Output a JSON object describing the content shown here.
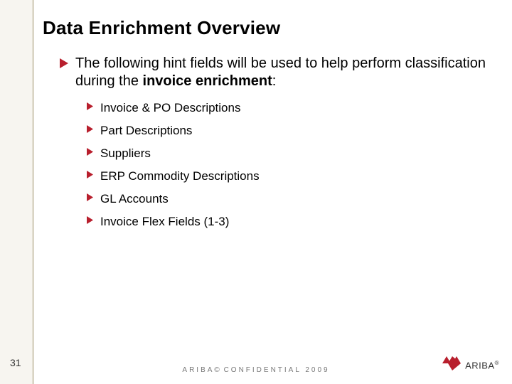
{
  "title": "Data Enrichment Overview",
  "lead": {
    "pre": "The following hint fields will be used to help perform classification during the ",
    "bold": "invoice enrichment",
    "post": ":"
  },
  "items": [
    "Invoice & PO Descriptions",
    "Part Descriptions",
    "Suppliers",
    "ERP Commodity Descriptions",
    "GL Accounts",
    "Invoice Flex Fields (1-3)"
  ],
  "page_number": "31",
  "footer": {
    "brand": "ARIBA",
    "copyright": "©",
    "label": "CONFIDENTIAL",
    "year": "2009"
  },
  "logo": {
    "text": "ARIBA",
    "reg": "®"
  }
}
